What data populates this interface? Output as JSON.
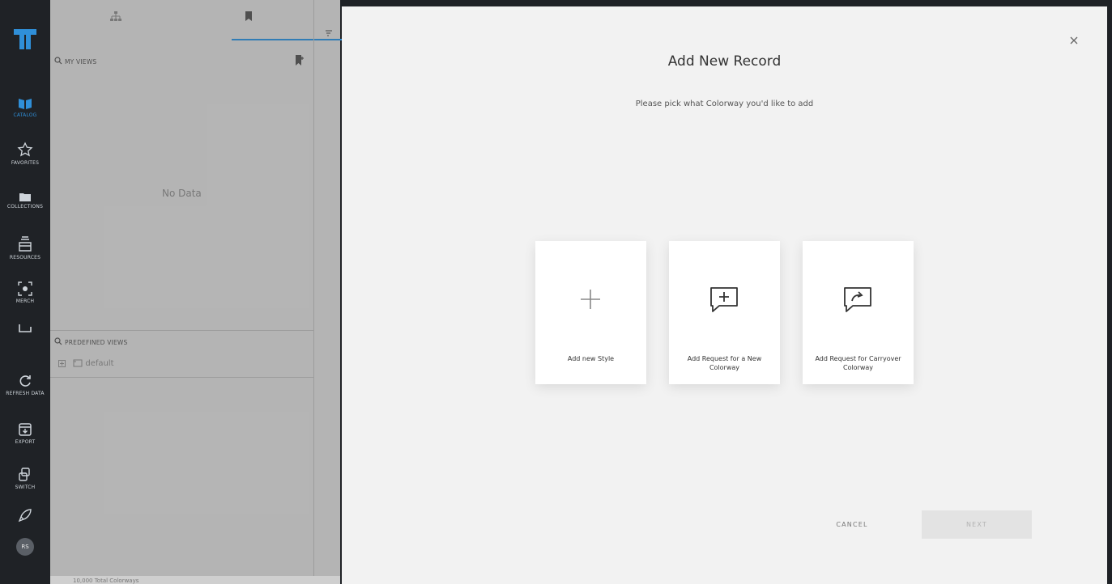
{
  "sidebar": {
    "items": [
      {
        "label": "CATALOG",
        "icon": "catalog-icon",
        "active": true
      },
      {
        "label": "FAVORITES",
        "icon": "star-icon"
      },
      {
        "label": "COLLECTIONS",
        "icon": "folder-icon"
      },
      {
        "label": "RESOURCES",
        "icon": "resources-icon"
      },
      {
        "label": "MERCH",
        "icon": "merch-icon"
      },
      {
        "label": "REFRESH DATA",
        "icon": "refresh-icon"
      },
      {
        "label": "EXPORT",
        "icon": "export-icon"
      },
      {
        "label": "SWITCH",
        "icon": "switch-icon"
      }
    ],
    "avatar_initials": "RS",
    "active_color": "#2f8fd8"
  },
  "views_panel": {
    "my_views_title": "MY VIEWS",
    "no_data": "No Data",
    "predefined_title": "PREDEFINED VIEWS",
    "predefined_items": [
      {
        "label": "default"
      }
    ],
    "footer_text": "10,000 Total Colorways"
  },
  "modal": {
    "title": "Add New Record",
    "subtitle": "Please pick what Colorway you'd like to add",
    "options": [
      {
        "label": "Add new Style",
        "icon": "plus-icon"
      },
      {
        "label": "Add Request for a New Colorway",
        "icon": "comment-plus-icon"
      },
      {
        "label": "Add Request for Carryover Colorway",
        "icon": "comment-carryover-icon"
      }
    ],
    "cancel_label": "CANCEL",
    "next_label": "NEXT"
  }
}
